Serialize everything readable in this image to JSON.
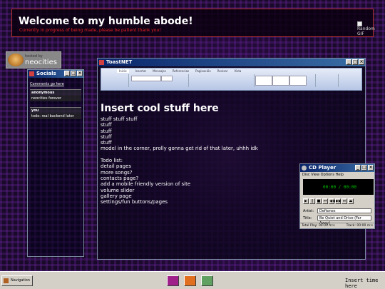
{
  "header": {
    "title": "Welcome to my humble abode!",
    "subtitle": "Currently in progress of being made, please be patient thank you!",
    "gif_alt": "Random GIF"
  },
  "neocities": {
    "hosted_by": "hosted by",
    "name": "neocities"
  },
  "socials": {
    "title": "Socials",
    "link": "Comments go here",
    "comments": [
      {
        "name": "anonymous",
        "message": "neocities forever"
      },
      {
        "name": "you",
        "message": "todo: real backend later"
      }
    ]
  },
  "toast": {
    "title": "ToastNET",
    "ribbon_tabs": [
      "Inicio",
      "Insertar",
      "Mensajes",
      "Referencias",
      "Paginación",
      "Revisar",
      "Vista"
    ],
    "heading": "Insert cool stuff here",
    "lines": [
      "stuff stuff stuff",
      "stuff",
      "stuff",
      "stuff",
      "stuff",
      "model in the corner, prolly gonna get rid of that later, uhhh idk",
      "",
      "Todo list:",
      "detail pages",
      "more songs?",
      "contacts page?",
      "add a mobile friendly version of site",
      "volume slider",
      "gallery page",
      "settings/fun buttons/pages"
    ]
  },
  "cd": {
    "title": "CD Player",
    "menu": [
      "Disc",
      "View",
      "Options",
      "Help"
    ],
    "time": "00:00 / 00:00",
    "artist_label": "Artist:",
    "artist": "Deftones",
    "title_label": "Title:",
    "track_title": "Be Quiet and Drive (Far Away)",
    "total_play": "Total Play: 00:00 m:s",
    "track": "Track: 00:00 m:s"
  },
  "taskbar": {
    "start_label": "Navigation",
    "clock": "Insert time here"
  },
  "colors": {
    "titlebar": "#0a246a",
    "header_accent": "#e02020",
    "lcd_text": "#00c000"
  }
}
